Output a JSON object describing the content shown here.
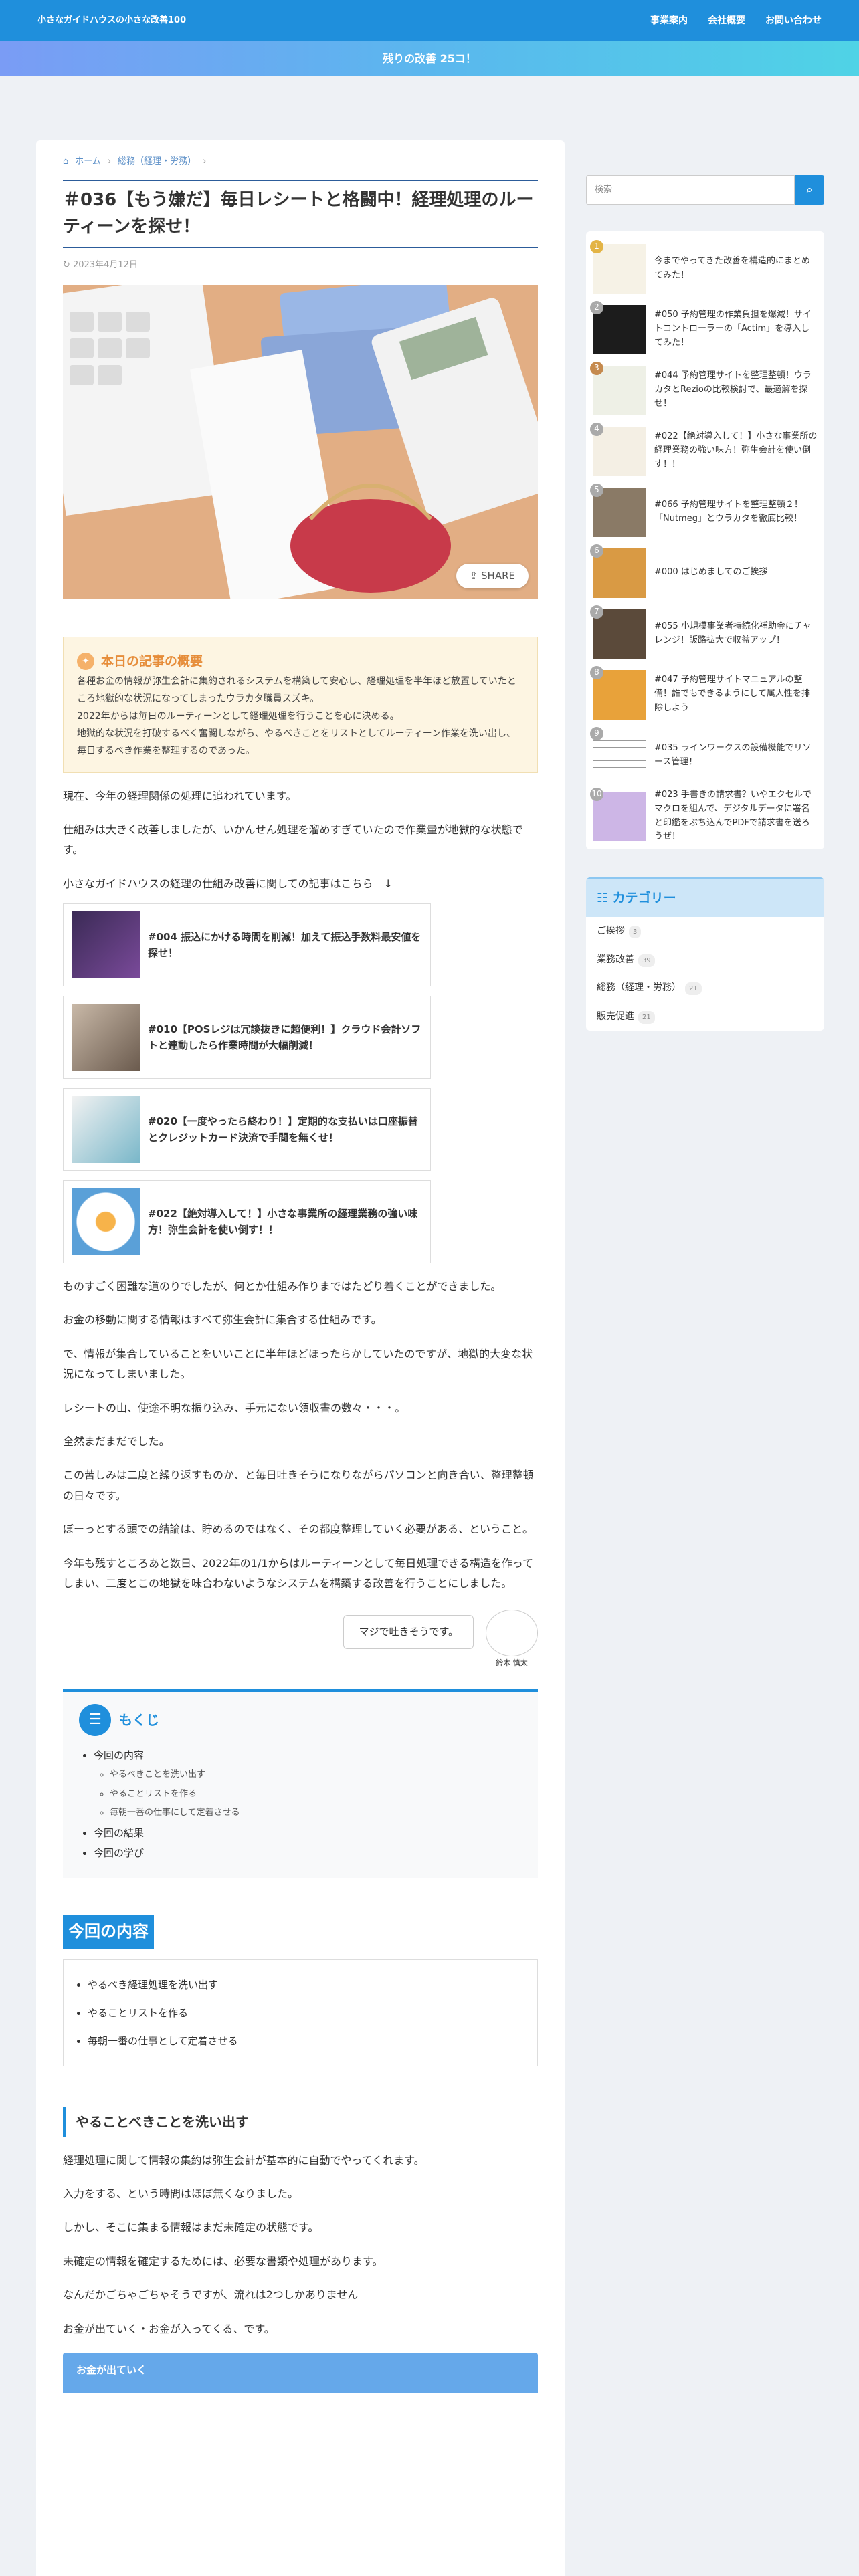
{
  "header": {
    "site_title": "小さなガイドハウスの小さな改善100",
    "nav": [
      "事業案内",
      "会社概要",
      "お問い合わせ"
    ]
  },
  "notice": "残りの改善 25コ！",
  "breadcrumb": {
    "home": "ホーム",
    "category": "総務（経理・労務）"
  },
  "article": {
    "title": "＃036【もう嫌だ】毎日レシートと格闘中！経理処理のルーティーンを探せ！",
    "date": "2023年4月12日",
    "share_label": "SHARE",
    "summary_title": "本日の記事の概要",
    "summary_lines": [
      "各種お金の情報が弥生会計に集約されるシステムを構築して安心し、経理処理を半年ほど放置していたところ地獄的な状況になってしまったウラカタ職員スズキ。",
      "2022年からは毎日のルーティーンとして経理処理を行うことを心に決める。",
      "地獄的な状況を打破するべく奮闘しながら、やるべきことをリストとしてルーティーン作業を洗い出し、毎日するべき作業を整理するのであった。"
    ],
    "intro": [
      "現在、今年の経理関係の処理に追われています。",
      "仕組みは大きく改善しましたが、いかんせん処理を溜めすぎていたので作業量が地獄的な状態です。",
      "小さなガイドハウスの経理の仕組み改善に関しての記事はこちら　↓"
    ],
    "cards": [
      "#004 振込にかける時間を削減！加えて振込手数料最安値を探せ！",
      "#010【POSレジは冗談抜きに超便利！】クラウド会計ソフトと連動したら作業時間が大幅削減！",
      "#020【一度やったら終わり！】定期的な支払いは口座振替とクレジットカード決済で手間を無くせ！",
      "#022【絶対導入して！】小さな事業所の経理業務の強い味方！弥生会計を使い倒す！！"
    ],
    "body": [
      "ものすごく困難な道のりでしたが、何とか仕組み作りまではたどり着くことができました。",
      "お金の移動に関する情報はすべて弥生会計に集合する仕組みです。",
      "で、情報が集合していることをいいことに半年ほどほったらかしていたのですが、地獄的大変な状況になってしまいました。",
      "レシートの山、使途不明な振り込み、手元にない領収書の数々・・・。",
      "全然まだまだでした。",
      "この苦しみは二度と繰り返すものか、と毎日吐きそうになりながらパソコンと向き合い、整理整頓の日々です。",
      "ぼーっとする頭での結論は、貯めるのではなく、その都度整理していく必要がある、ということ。",
      "今年も残すところあと数日、2022年の1/1からはルーティーンとして毎日処理できる構造を作ってしまい、二度とこの地獄を味合わないようなシステムを構築する改善を行うことにしました。"
    ],
    "speech_text": "マジで吐きそうです。",
    "speaker_name": "鈴木 慎太",
    "toc": {
      "title": "もくじ",
      "items": [
        {
          "label": "今回の内容",
          "children": [
            "やるべきことを洗い出す",
            "やることリストを作る",
            "毎朝一番の仕事にして定着させる"
          ]
        },
        {
          "label": "今回の結果",
          "children": []
        },
        {
          "label": "今回の学び",
          "children": []
        }
      ]
    },
    "section_title": "今回の内容",
    "section_list": [
      "やるべき経理処理を洗い出す",
      "やることリストを作る",
      "毎朝一番の仕事として定着させる"
    ],
    "sub_title": "やることべきことを洗い出す",
    "sub_body": [
      "経理処理に関して情報の集約は弥生会計が基本的に自動でやってくれます。",
      "入力をする、という時間はほぼ無くなりました。",
      "しかし、そこに集まる情報はまだ未確定の状態です。",
      "未確定の情報を確定するためには、必要な書類や処理があります。",
      "なんだかごちゃごちゃそうですが、流れは2つしかありません",
      "お金が出ていく・お金が入ってくる、です。"
    ],
    "caption_box": "お金が出ていく"
  },
  "sidebar": {
    "search_placeholder": "検索",
    "ranking": [
      {
        "num": "1",
        "title": "今までやってきた改善を構造的にまとめてみた！"
      },
      {
        "num": "2",
        "title": "#050 予約管理の作業負担を爆減！サイトコントローラーの「Actim」を導入してみた！"
      },
      {
        "num": "3",
        "title": "#044 予約管理サイトを整理整頓！ウラカタとRezioの比較検討で、最適解を探せ！"
      },
      {
        "num": "4",
        "title": "#022【絶対導入して！】小さな事業所の経理業務の強い味方！弥生会計を使い倒す！！"
      },
      {
        "num": "5",
        "title": "#066 予約管理サイトを整理整頓２！「Nutmeg」とウラカタを徹底比較！"
      },
      {
        "num": "6",
        "title": "#000 はじめましてのご挨拶"
      },
      {
        "num": "7",
        "title": "#055 小規模事業者持続化補助金にチャレンジ！販路拡大で収益アップ！"
      },
      {
        "num": "8",
        "title": "#047 予約管理サイトマニュアルの整備！誰でもできるようにして属人性を排除しよう"
      },
      {
        "num": "9",
        "title": "#035 ラインワークスの設備機能でリソース管理！"
      },
      {
        "num": "10",
        "title": "#023 手書きの請求書？いやエクセルでマクロを組んで、デジタルデータに署名と印鑑をぶち込んでPDFで請求書を送ろうぜ！"
      }
    ],
    "category_title": "カテゴリー",
    "categories": [
      {
        "name": "ご挨拶",
        "count": "3"
      },
      {
        "name": "業務改善",
        "count": "39"
      },
      {
        "name": "総務（経理・労務）",
        "count": "21"
      },
      {
        "name": "販売促進",
        "count": "21"
      }
    ]
  },
  "colors": {
    "accent": "#1f8fdc",
    "summary_bg": "#fdf5e2",
    "summary_accent": "#e68d3a"
  }
}
